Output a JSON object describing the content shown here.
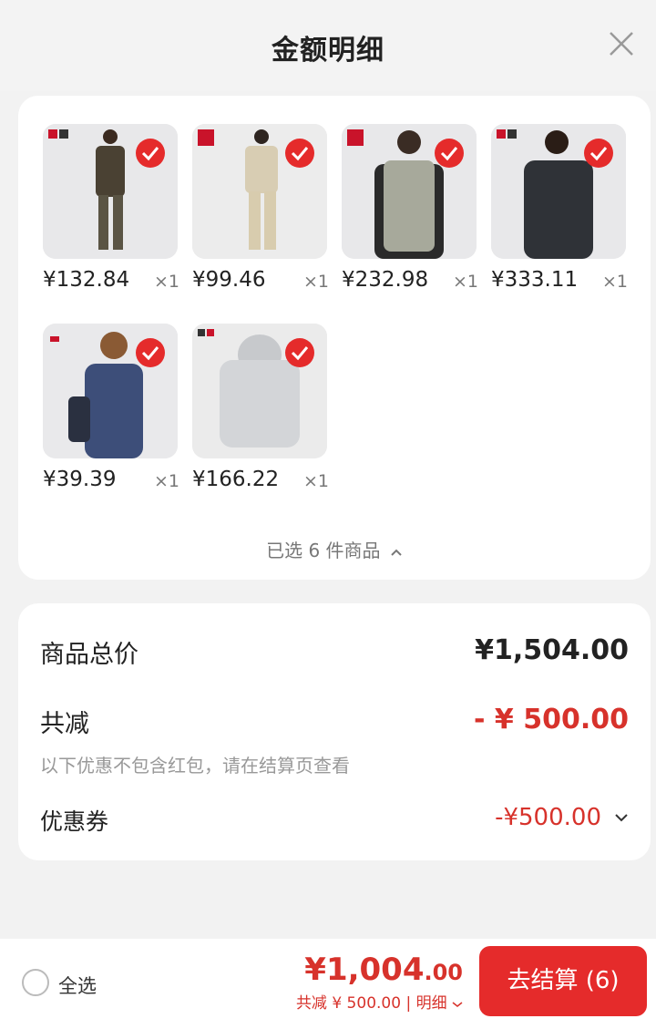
{
  "sheet": {
    "title": "金额明细"
  },
  "products": [
    {
      "price": "¥132.84",
      "qty": "×1",
      "brand": "U",
      "image": "person-brown-jacket"
    },
    {
      "price": "¥99.46",
      "qty": "×1",
      "brand": "UNIQLO",
      "image": "person-beige-outfit"
    },
    {
      "price": "¥232.98",
      "qty": "×1",
      "brand": "UNIQLO",
      "image": "person-padded-vest"
    },
    {
      "price": "¥333.11",
      "qty": "×1",
      "brand": "U",
      "image": "person-dark-hoodie-jacket"
    },
    {
      "price": "¥39.39",
      "qty": "×1",
      "brand": "JW ANDERSON",
      "image": "person-navy-tee"
    },
    {
      "price": "¥166.22",
      "qty": "×1",
      "brand": "+C",
      "image": "grey-hoodie"
    }
  ],
  "selected_text": "已选 6 件商品",
  "summary": {
    "subtotal_label": "商品总价",
    "subtotal_value": "¥1,504.00",
    "discount_label": "共减",
    "discount_value": "- ¥ 500.00",
    "note": "以下优惠不包含红包，请在结算页查看",
    "coupon_label": "优惠券",
    "coupon_value": "-¥500.00"
  },
  "bottom": {
    "select_all": "全选",
    "total_main": "¥1,004",
    "total_decimal": ".00",
    "savings": "共减 ¥ 500.00 | 明细",
    "checkout": "去结算 (6)"
  },
  "colors": {
    "accent": "#e52b2b",
    "price_red": "#d7322b"
  }
}
